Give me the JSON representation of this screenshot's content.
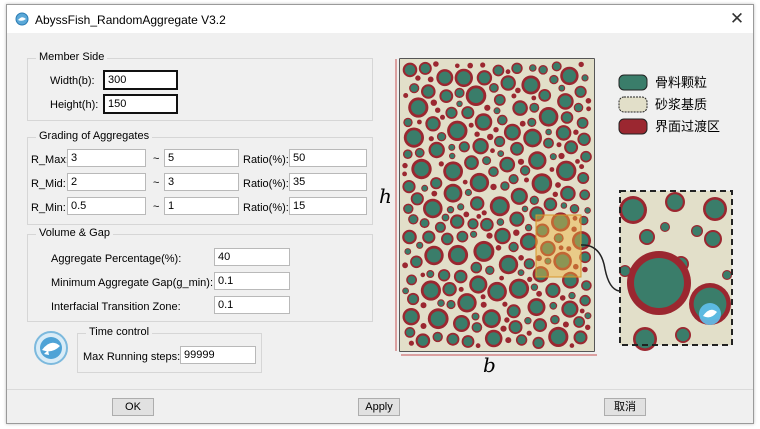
{
  "window": {
    "title": "AbyssFish_RandomAggregate V3.2",
    "close_glyph": "✕"
  },
  "member_side": {
    "title": "Member Side",
    "width_label": "Width(b):",
    "width_value": "300",
    "height_label": "Height(h):",
    "height_value": "150"
  },
  "grading": {
    "title": "Grading of Aggregates",
    "rows": [
      {
        "label": "R_Max:",
        "min": "3",
        "tilde": "~",
        "max": "5",
        "ratio_label": "Ratio(%):",
        "ratio": "50"
      },
      {
        "label": "R_Mid:",
        "min": "2",
        "tilde": "~",
        "max": "3",
        "ratio_label": "Ratio(%):",
        "ratio": "35"
      },
      {
        "label": "R_Min:",
        "min": "0.5",
        "tilde": "~",
        "max": "1",
        "ratio_label": "Ratio(%):",
        "ratio": "15"
      }
    ]
  },
  "volume_gap": {
    "title": "Volume & Gap",
    "aggregate_percentage_label": "Aggregate Percentage(%):",
    "aggregate_percentage_value": "40",
    "min_gap_label": "Minimum Aggregate Gap(g_min):",
    "min_gap_value": "0.1",
    "itz_label": "Interfacial Transition Zone:",
    "itz_value": "0.1"
  },
  "time_control": {
    "title": "Time control",
    "max_steps_label": "Max Running steps:",
    "max_steps_value": "99999"
  },
  "buttons": {
    "ok": "OK",
    "apply": "Apply",
    "cancel": "取消"
  },
  "figure": {
    "axis_h": "h",
    "axis_b": "b",
    "legend": [
      {
        "label": "骨料颗粒",
        "color": "#3a7d6a"
      },
      {
        "label": "砂浆基质",
        "color": "#e2dfc9"
      },
      {
        "label": "界面过渡区",
        "color": "#9b2730"
      }
    ]
  },
  "colors": {
    "aggregate": "#3a7d6a",
    "matrix": "#e2dfc9",
    "itz": "#9b2730",
    "highlight": "#f2b43a"
  }
}
